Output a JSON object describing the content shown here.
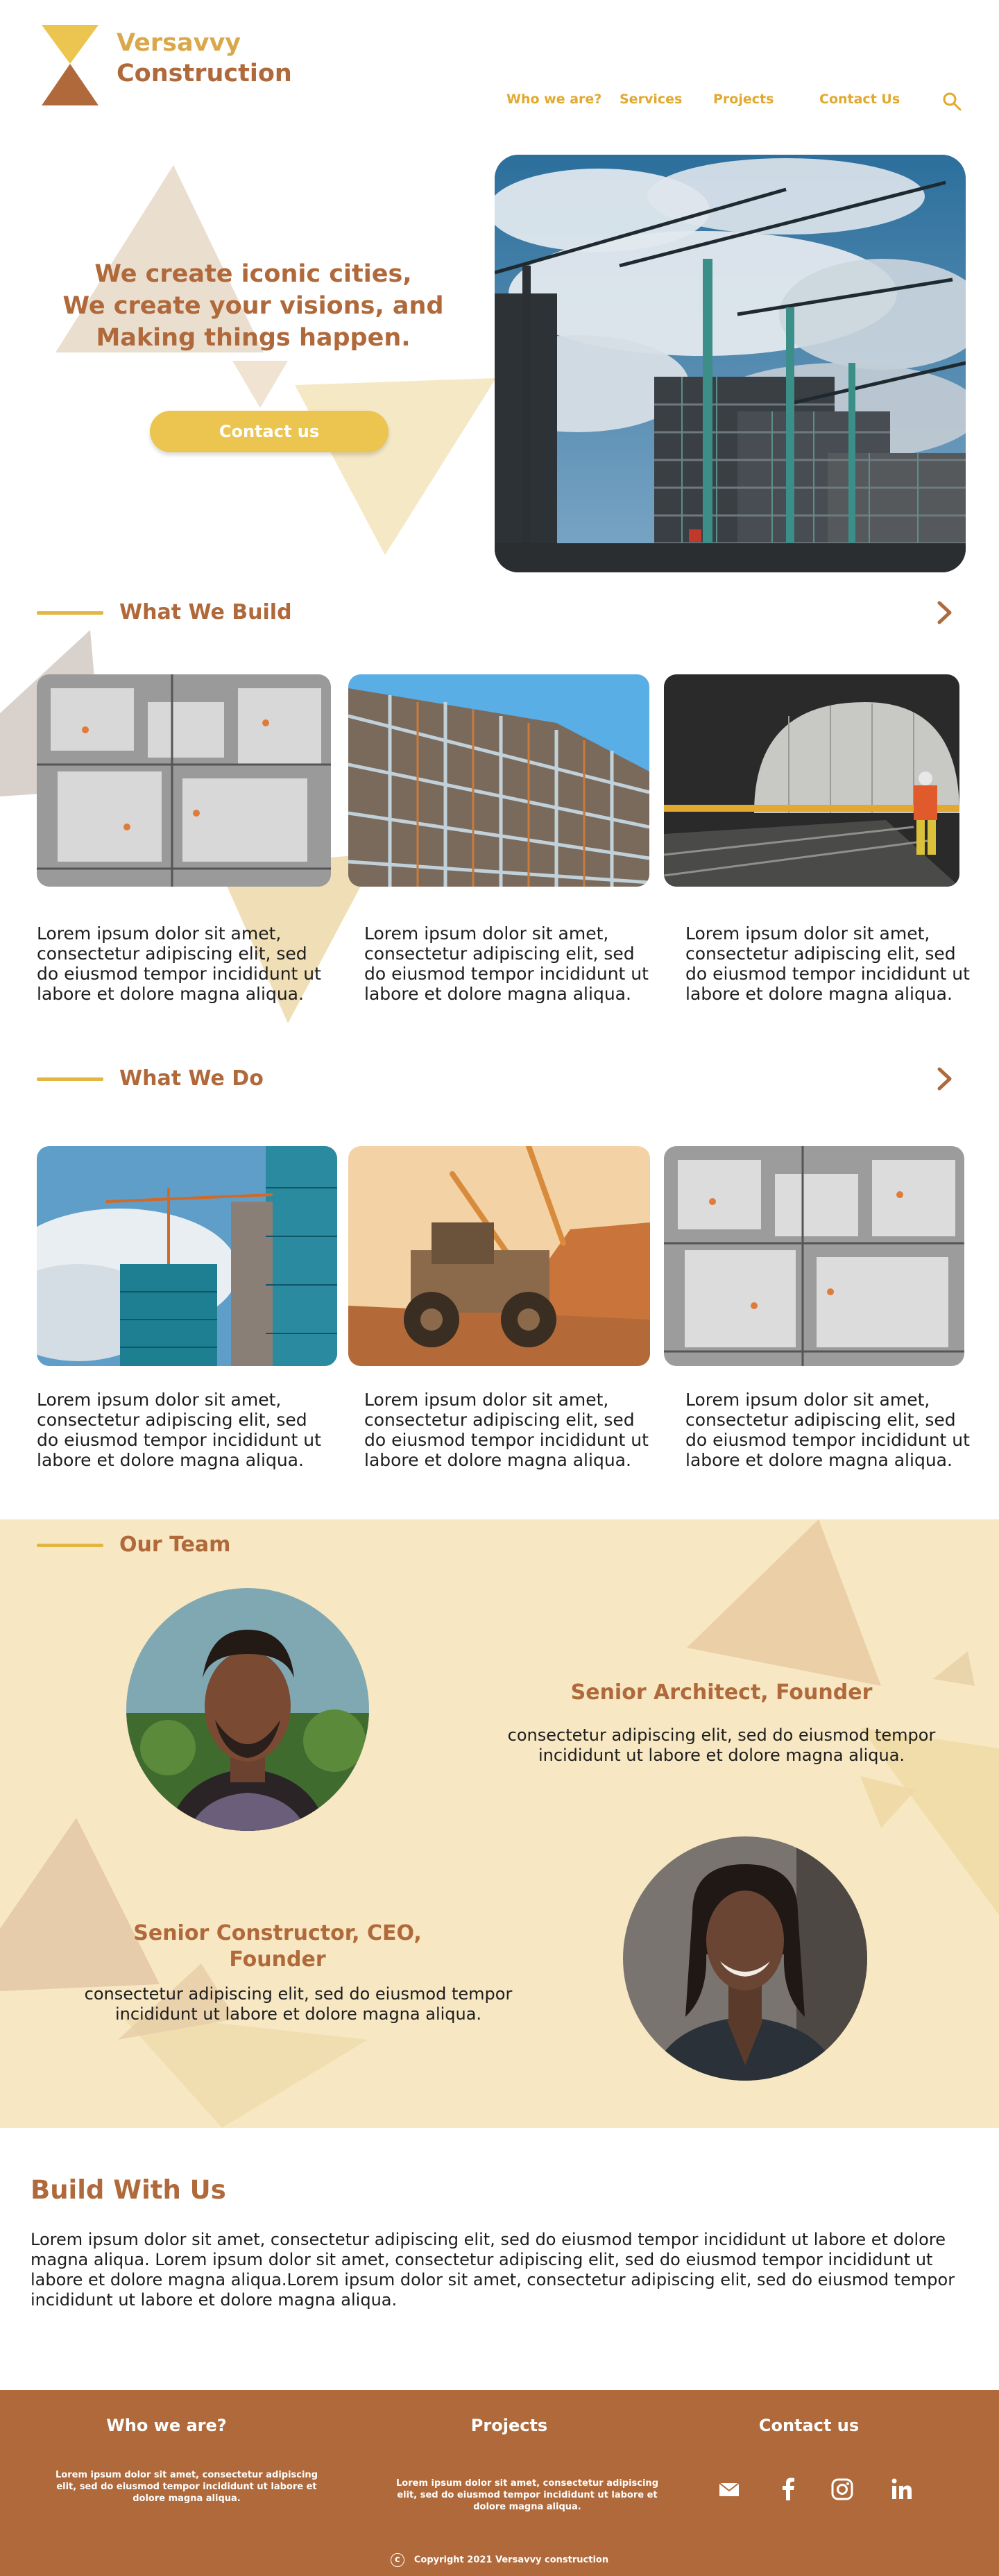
{
  "brand": {
    "line1": "Versavvy",
    "line2": "Construction"
  },
  "nav": {
    "items": [
      "Who we are?",
      "Services",
      "Projects",
      "Contact Us"
    ],
    "search_icon": "search-icon"
  },
  "hero": {
    "lines": [
      "We create iconic cities,",
      "We create your visions, and",
      "Making things happen."
    ],
    "cta": "Contact us"
  },
  "what_we_build": {
    "title": "What We Build",
    "cards": [
      {
        "text": "Lorem ipsum dolor sit amet, consectetur adipiscing elit, sed do eiusmod tempor incididunt ut labore et dolore magna aliqua."
      },
      {
        "text": "Lorem ipsum dolor sit amet, consectetur adipiscing elit, sed do eiusmod tempor incididunt ut labore et dolore magna aliqua."
      },
      {
        "text": "Lorem ipsum dolor sit amet, consectetur adipiscing elit, sed do eiusmod tempor incididunt ut labore et dolore magna aliqua."
      }
    ]
  },
  "what_we_do": {
    "title": "What We Do",
    "cards": [
      {
        "text": "Lorem ipsum dolor sit amet, consectetur adipiscing elit, sed do eiusmod tempor incididunt ut labore et dolore magna aliqua."
      },
      {
        "text": "Lorem ipsum dolor sit amet, consectetur adipiscing elit, sed do eiusmod tempor incididunt ut labore et dolore magna aliqua."
      },
      {
        "text": "Lorem ipsum dolor sit amet, consectetur adipiscing elit, sed do eiusmod tempor incididunt ut labore et dolore magna aliqua."
      }
    ]
  },
  "team": {
    "title": "Our Team",
    "members": [
      {
        "role": "Senior Architect, Founder",
        "desc": "consectetur adipiscing elit, sed do eiusmod tempor incididunt ut labore et dolore magna aliqua."
      },
      {
        "role_line1": "Senior Constructor, CEO,",
        "role_line2": "Founder",
        "desc": "consectetur adipiscing elit, sed do eiusmod tempor incididunt ut labore et dolore magna aliqua."
      }
    ]
  },
  "build_with_us": {
    "title": "Build With Us",
    "text": "Lorem ipsum dolor sit amet, consectetur adipiscing elit, sed do eiusmod tempor incididunt ut labore et dolore magna aliqua. Lorem ipsum dolor sit amet, consectetur adipiscing elit, sed do eiusmod tempor incididunt ut labore et dolore magna aliqua.Lorem ipsum dolor sit amet, consectetur adipiscing elit, sed do eiusmod tempor incididunt ut labore et dolore magna aliqua."
  },
  "footer": {
    "columns": [
      {
        "title": "Who we are?",
        "text": "Lorem ipsum dolor sit amet, consectetur adipiscing elit, sed do eiusmod tempor incididunt ut labore et dolore magna aliqua."
      },
      {
        "title": "Projects",
        "text": "Lorem ipsum dolor sit amet, consectetur adipiscing elit, sed do eiusmod tempor incididunt ut labore et dolore magna aliqua."
      },
      {
        "title": "Contact us"
      }
    ],
    "social_icons": [
      "mail-icon",
      "facebook-icon",
      "instagram-icon",
      "linkedin-icon"
    ],
    "copyright_symbol": "c",
    "copyright": "Copyright 2021 Versavvy construction"
  },
  "colors": {
    "gold": "#e2a92e",
    "brown": "#b0693a",
    "cream": "#f7e8c3",
    "button": "#ecc550"
  }
}
